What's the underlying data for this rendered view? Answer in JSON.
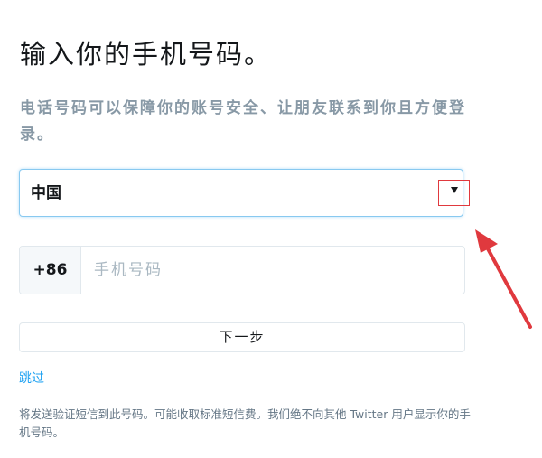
{
  "page": {
    "title": "输入你的手机号码。",
    "subtitle": "电话号码可以保障你的账号安全、让朋友联系到你且方便登录。"
  },
  "country_select": {
    "value": "中国"
  },
  "phone": {
    "country_code": "+86",
    "placeholder": "手机号码",
    "value": ""
  },
  "actions": {
    "next_label": "下一步",
    "skip_label": "跳过"
  },
  "disclaimer": "将发送验证短信到此号码。可能收取标准短信费。我们绝不向其他 Twitter 用户显示你的手机号码。",
  "colors": {
    "accent": "#1da1f2",
    "annotation": "#e0393e",
    "muted_text": "#8899a6"
  }
}
